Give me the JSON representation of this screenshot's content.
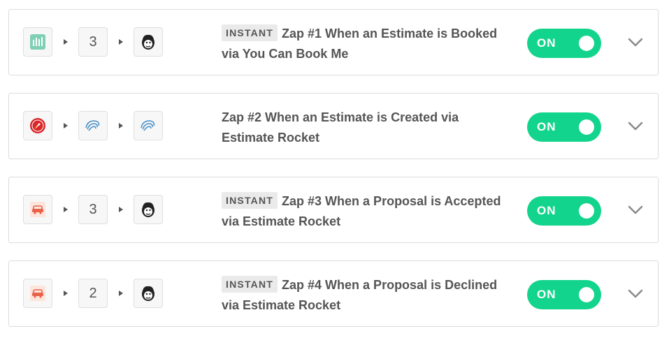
{
  "zaps": [
    {
      "badge": "INSTANT",
      "title": "Zap #1 When an Estimate is Booked via You Can Book Me",
      "middle_type": "count",
      "step_count": "3",
      "toggle_label": "ON"
    },
    {
      "badge": "",
      "title": "Zap #2 When an Estimate is Created via Estimate Rocket",
      "middle_type": "icon",
      "step_count": "",
      "toggle_label": "ON"
    },
    {
      "badge": "INSTANT",
      "title": "Zap #3 When a Proposal is Accepted via Estimate Rocket",
      "middle_type": "count",
      "step_count": "3",
      "toggle_label": "ON"
    },
    {
      "badge": "INSTANT",
      "title": "Zap #4 When a Proposal is Declined via Estimate Rocket",
      "middle_type": "count",
      "step_count": "2",
      "toggle_label": "ON"
    }
  ],
  "icons": {
    "trigger_1": "you-can-book-me-icon",
    "trigger_2": "estimate-rocket-icon",
    "trigger_3": "estimate-rocket-proposal-icon",
    "trigger_4": "estimate-rocket-proposal-icon",
    "action": "mailchimp-icon",
    "swirl": "swirl-app-icon",
    "expand": "chevron-down-icon"
  },
  "colors": {
    "toggle_on": "#13d48c",
    "text": "#555555",
    "badge_bg": "#eaeaea"
  }
}
